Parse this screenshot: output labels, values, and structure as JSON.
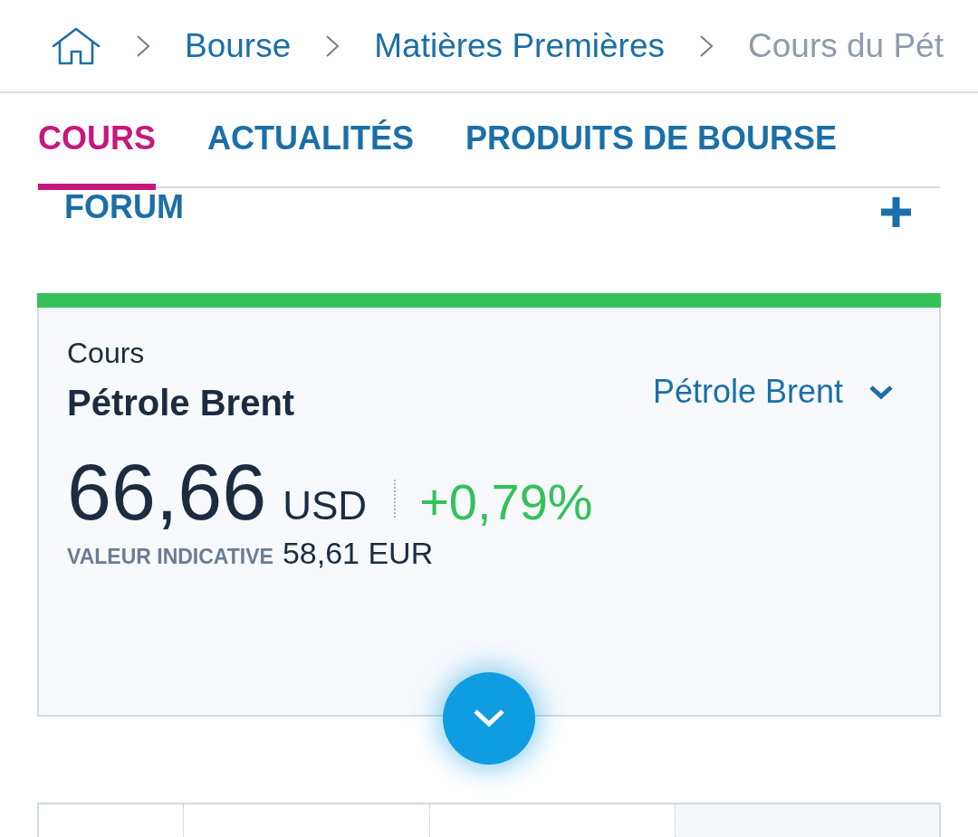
{
  "breadcrumb": {
    "items": [
      {
        "label": "Bourse",
        "current": false
      },
      {
        "label": "Matières Premières",
        "current": false
      },
      {
        "label": "Cours du Pét",
        "current": true
      }
    ]
  },
  "tabs": [
    {
      "label": "COURS",
      "selected": true
    },
    {
      "label": "ACTUALITÉS",
      "selected": false
    },
    {
      "label": "PRODUITS DE BOURSE",
      "selected": false
    },
    {
      "label": "FORUM",
      "selected": false
    }
  ],
  "quote": {
    "label": "Cours",
    "name": "Pétrole Brent",
    "selector": "Pétrole Brent",
    "price": "66,66",
    "currency": "USD",
    "change": "+0,79%",
    "positive": true,
    "indicative_label": "VALEUR INDICATIVE",
    "indicative_value": "58,61 EUR"
  }
}
